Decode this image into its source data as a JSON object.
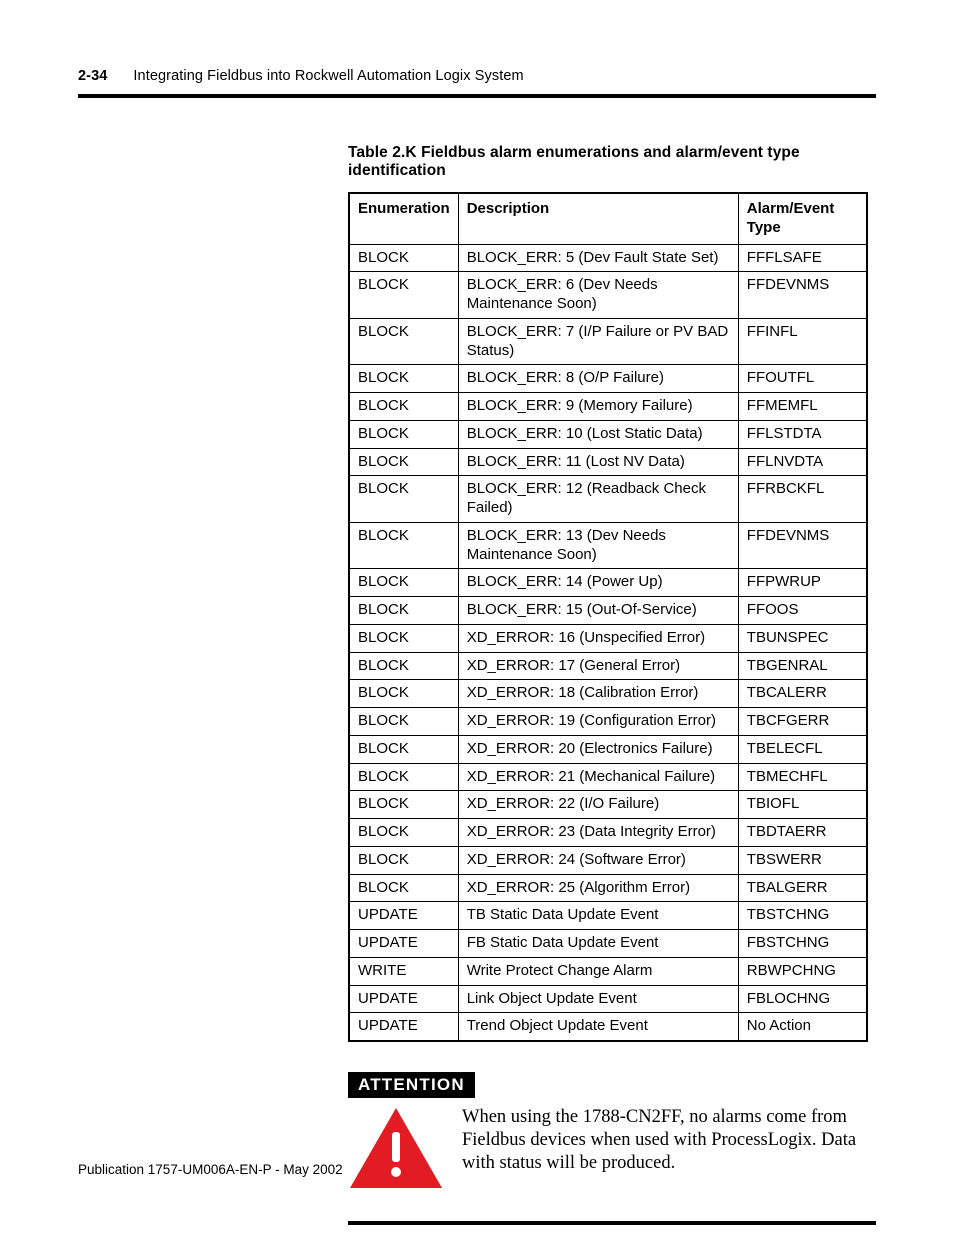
{
  "header": {
    "page_number": "2-34",
    "title": "Integrating Fieldbus into Rockwell Automation Logix System"
  },
  "table": {
    "caption": "Table 2.K Fieldbus alarm enumerations and alarm/event type identification",
    "columns": [
      "Enumeration",
      "Description",
      "Alarm/Event Type"
    ],
    "rows": [
      [
        "BLOCK",
        "BLOCK_ERR: 5 (Dev Fault State Set)",
        "FFFLSAFE"
      ],
      [
        "BLOCK",
        "BLOCK_ERR: 6 (Dev Needs Maintenance Soon)",
        "FFDEVNMS"
      ],
      [
        "BLOCK",
        "BLOCK_ERR: 7 (I/P Failure or PV BAD Status)",
        "FFINFL"
      ],
      [
        "BLOCK",
        "BLOCK_ERR: 8 (O/P Failure)",
        "FFOUTFL"
      ],
      [
        "BLOCK",
        "BLOCK_ERR: 9 (Memory Failure)",
        "FFMEMFL"
      ],
      [
        "BLOCK",
        "BLOCK_ERR: 10 (Lost Static Data)",
        "FFLSTDTA"
      ],
      [
        "BLOCK",
        "BLOCK_ERR: 11 (Lost NV Data)",
        "FFLNVDTA"
      ],
      [
        "BLOCK",
        "BLOCK_ERR: 12 (Readback Check Failed)",
        "FFRBCKFL"
      ],
      [
        "BLOCK",
        "BLOCK_ERR: 13 (Dev Needs Maintenance Soon)",
        "FFDEVNMS"
      ],
      [
        "BLOCK",
        "BLOCK_ERR: 14 (Power Up)",
        "FFPWRUP"
      ],
      [
        "BLOCK",
        "BLOCK_ERR: 15 (Out-Of-Service)",
        "FFOOS"
      ],
      [
        "BLOCK",
        "XD_ERROR: 16 (Unspecified Error)",
        "TBUNSPEC"
      ],
      [
        "BLOCK",
        "XD_ERROR: 17 (General Error)",
        "TBGENRAL"
      ],
      [
        "BLOCK",
        "XD_ERROR: 18 (Calibration Error)",
        "TBCALERR"
      ],
      [
        "BLOCK",
        "XD_ERROR: 19 (Configuration Error)",
        "TBCFGERR"
      ],
      [
        "BLOCK",
        "XD_ERROR: 20 (Electronics Failure)",
        "TBELECFL"
      ],
      [
        "BLOCK",
        "XD_ERROR: 21 (Mechanical Failure)",
        "TBMECHFL"
      ],
      [
        "BLOCK",
        "XD_ERROR: 22 (I/O Failure)",
        "TBIOFL"
      ],
      [
        "BLOCK",
        "XD_ERROR: 23 (Data Integrity Error)",
        "TBDTAERR"
      ],
      [
        "BLOCK",
        "XD_ERROR: 24 (Software Error)",
        "TBSWERR"
      ],
      [
        "BLOCK",
        "XD_ERROR: 25 (Algorithm Error)",
        "TBALGERR"
      ],
      [
        "UPDATE",
        "TB Static Data Update Event",
        "TBSTCHNG"
      ],
      [
        "UPDATE",
        "FB Static Data Update Event",
        "FBSTCHNG"
      ],
      [
        "WRITE",
        "Write Protect Change Alarm",
        "RBWPCHNG"
      ],
      [
        "UPDATE",
        "Link Object Update Event",
        "FBLOCHNG"
      ],
      [
        "UPDATE",
        "Trend Object Update Event",
        "No Action"
      ]
    ]
  },
  "attention": {
    "label": "ATTENTION",
    "text": "When using the 1788-CN2FF, no alarms come from Fieldbus devices when used with ProcessLogix. Data with status will be produced."
  },
  "footer": {
    "text": "Publication 1757-UM006A-EN-P - May 2002"
  }
}
